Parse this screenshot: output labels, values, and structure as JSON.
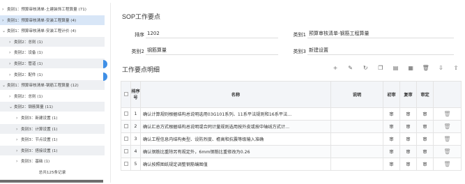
{
  "tree": {
    "items": [
      {
        "label": "类别1：预算审核清单-土建装饰工程算量 (71)",
        "level": 0,
        "expanded": false,
        "selected": false
      },
      {
        "label": "类别1：预算审核清单-安装工程算量 (4)",
        "level": 0,
        "expanded": false,
        "selected": true
      },
      {
        "label": "类别1：预算审核清单-安装工程计价 (4)",
        "level": 0,
        "expanded": true,
        "selected": false
      },
      {
        "label": "类别2：总则 (1)",
        "level": 1,
        "expanded": false,
        "selected": false
      },
      {
        "label": "类别2：设备 (1)",
        "level": 1,
        "expanded": false,
        "selected": false
      },
      {
        "label": "类别2：管道 (1)",
        "level": 1,
        "expanded": false,
        "selected": false
      },
      {
        "label": "类别2：配件 (1)",
        "level": 1,
        "expanded": false,
        "selected": false
      },
      {
        "label": "类别1：预算审核清单-钢筋工程算量 (12)",
        "level": 0,
        "expanded": true,
        "selected": false
      },
      {
        "label": "类别2：总则 (1)",
        "level": 1,
        "expanded": false,
        "selected": false
      },
      {
        "label": "类别2：钢筋算量 (11)",
        "level": 1,
        "expanded": true,
        "selected": false
      },
      {
        "label": "类别3：新建设置 (1)",
        "level": 2,
        "expanded": false,
        "selected": false
      },
      {
        "label": "类别3：计算设置 (1)",
        "level": 2,
        "expanded": false,
        "selected": false
      },
      {
        "label": "类别3：节点设置 (1)",
        "level": 2,
        "expanded": false,
        "selected": false
      },
      {
        "label": "类别3：搭接设置 (1)",
        "level": 2,
        "expanded": false,
        "selected": false
      },
      {
        "label": "类别3：基础 (1)",
        "level": 2,
        "expanded": false,
        "selected": false
      }
    ],
    "footer": "总共125条记录"
  },
  "main": {
    "section_title": "SOP工作要点",
    "form": {
      "seq_label": "排序",
      "seq_value": "1202",
      "cat1_label": "类别1",
      "cat1_value": "预算审核清单-钢筋工程算量",
      "cat2_label": "类别2",
      "cat2_value": "钢筋算量",
      "cat3_label": "类别3",
      "cat3_value": "新建设置"
    },
    "detail_title": "工作要点明细",
    "toolbar_icons": [
      "plus-icon",
      "edit-icon",
      "refresh-icon",
      "copy-icon",
      "paste-icon",
      "grid-icon",
      "delete-icon",
      "import-icon",
      "export-icon"
    ],
    "table": {
      "headers": {
        "seq": "排序号",
        "name": "名称",
        "desc": "说明",
        "first": "初审",
        "second": "复审",
        "final": "审定"
      },
      "rows": [
        {
          "seq": "1",
          "name": "确认计算规则根据结构总说明选用03G101系列、11系平法规则和16系平法...",
          "desc": "",
          "first": "审",
          "second": "审",
          "final": "审"
        },
        {
          "seq": "2",
          "name": "确认汇总方式根据结构总说明或合同计量规则选用按外皮或按中轴线方式计...",
          "desc": "",
          "first": "审",
          "second": "审",
          "final": "审"
        },
        {
          "seq": "3",
          "name": "确认工程信息内结构类型、设防烈度、檐高和抗震等级输入准确",
          "desc": "",
          "first": "审",
          "second": "审",
          "final": "审"
        },
        {
          "seq": "4",
          "name": "确认钢筋比重除另有规定外，6mm钢筋比重修改为0.26",
          "desc": "",
          "first": "审",
          "second": "审",
          "final": "审"
        },
        {
          "seq": "5",
          "name": "确认按照图纸规定调整钢筋编图值",
          "desc": "",
          "first": "审",
          "second": "审",
          "final": "审"
        }
      ]
    }
  },
  "colors": {
    "selected_bg": "#d8e6f7",
    "alt_bg": "#eef0f3",
    "accent": "#3f8fe6",
    "header_bg": "#f3f5f8"
  }
}
